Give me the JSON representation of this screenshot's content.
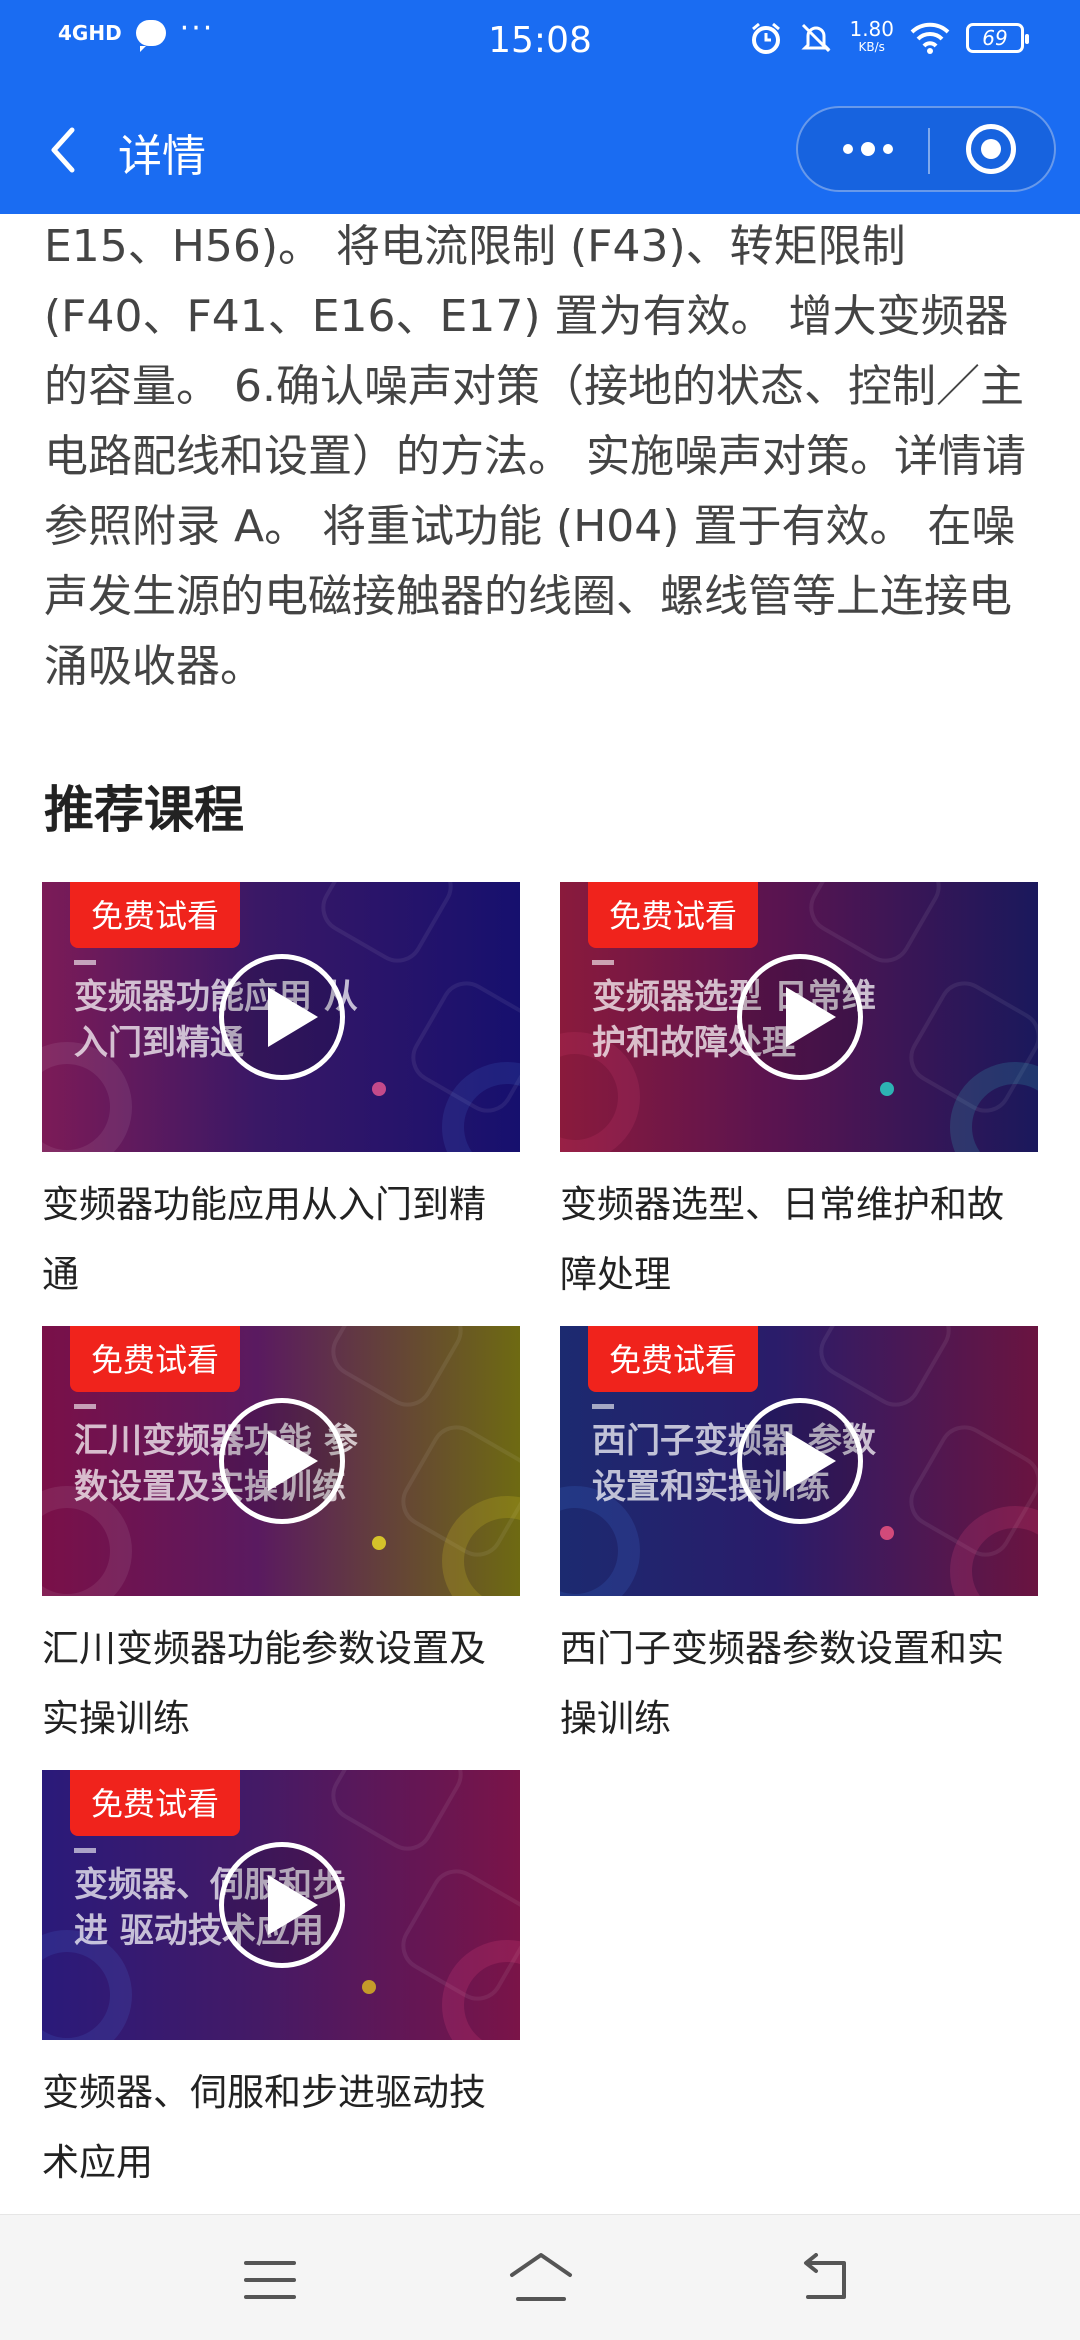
{
  "status_bar": {
    "network": "4GHD",
    "more": "···",
    "time": "15:08",
    "speed": "1.80",
    "speed_unit": "KB/s",
    "battery": "69"
  },
  "nav": {
    "title": "详情"
  },
  "article": {
    "text": "E15、H56)。 将电流限制 (F43)、转矩限制 (F40、F41、E16、E17) 置为有效。 增大变频器的容量。 6.确认噪声对策（接地的状态、控制／主电路配线和设置）的方法。 实施噪声对策。详情请参照附录 A。 将重试功能 (H04) 置于有效。 在噪声发生源的电磁接触器的线圈、螺线管等上连接电涌吸收器。"
  },
  "recommended": {
    "title": "推荐课程",
    "courses": [
      {
        "badge": "免费试看",
        "thumb_text": "变频器功能应用 从入门到精通",
        "title": "变频器功能应用从入门到精通"
      },
      {
        "badge": "免费试看",
        "thumb_text": "变频器选型 日常维护和故障处理",
        "title": "变频器选型、日常维护和故障处理"
      },
      {
        "badge": "免费试看",
        "thumb_text": "汇川变频器功能 参数设置及实操训练",
        "title": "汇川变频器功能参数设置及实操训练"
      },
      {
        "badge": "免费试看",
        "thumb_text": "西门子变频器 参数设置和实操训练",
        "title": "西门子变频器参数设置和实操训练"
      },
      {
        "badge": "免费试看",
        "thumb_text": "变频器、伺服和步进 驱动技术应用",
        "title": "变频器、伺服和步进驱动技术应用"
      }
    ]
  },
  "bottom_nav": {
    "icons": [
      "menu-icon",
      "home-icon",
      "back-icon"
    ]
  }
}
